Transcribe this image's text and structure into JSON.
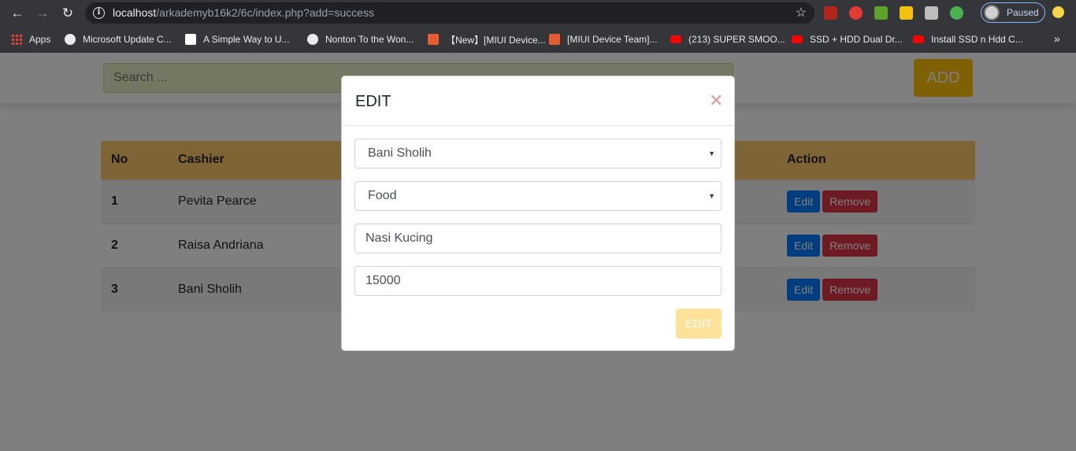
{
  "browser": {
    "url_host": "localhost",
    "url_path": "/arkademyb16k2/6c/index.php?add=success",
    "profile_label": "Paused",
    "bookmarks": [
      {
        "label": "Apps"
      },
      {
        "label": "Microsoft Update C..."
      },
      {
        "label": "A Simple Way to U..."
      },
      {
        "label": "Nonton To the Won..."
      },
      {
        "label": "【New】[MIUI Device..."
      },
      {
        "label": "[MIUI Device Team]..."
      },
      {
        "label": "(213) SUPER SMOO..."
      },
      {
        "label": "SSD + HDD Dual Dr..."
      },
      {
        "label": "Install SSD n Hdd C..."
      }
    ]
  },
  "page": {
    "search_placeholder": "Search ...",
    "add_label": "ADD",
    "table": {
      "headers": [
        "No",
        "Cashier",
        "Action"
      ],
      "rows": [
        {
          "no": "1",
          "cashier": "Pevita Pearce"
        },
        {
          "no": "2",
          "cashier": "Raisa Andriana"
        },
        {
          "no": "3",
          "cashier": "Bani Sholih"
        }
      ],
      "edit_label": "Edit",
      "remove_label": "Remove"
    }
  },
  "modal": {
    "title": "EDIT",
    "close_glyph": "×",
    "cashier_select": "Bani Sholih",
    "category_select": "Food",
    "name_value": "Nasi Kucing",
    "price_value": "15000",
    "submit_label": "EDIT"
  },
  "colors": {
    "table_header": "#ffc86a",
    "edit_button": "#007bff",
    "remove_button": "#dc3545",
    "add_button": "#ffc107"
  }
}
